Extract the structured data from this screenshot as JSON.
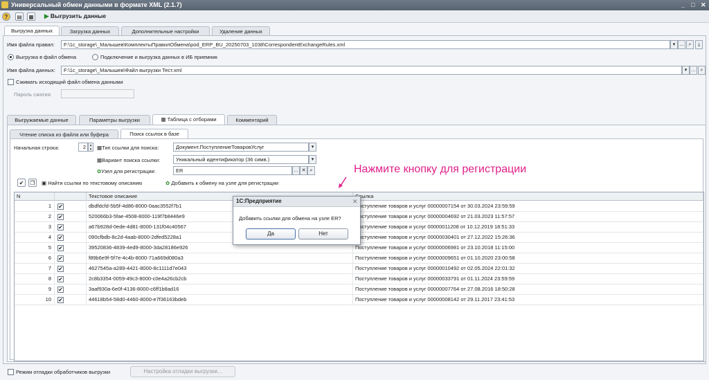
{
  "window": {
    "title": "Универсальный обмен данными в формате XML (2.1.7)"
  },
  "toolbar": {
    "export_label": "Выгрузить данные"
  },
  "main_tabs": [
    "Выгрузка данных",
    "Загрузка данных",
    "Дополнительные настройки",
    "Удаление данных"
  ],
  "rules": {
    "label": "Имя файла правил:",
    "value": "F:\\1c_storage\\_Малышев\\КомплектыПравилОбмена\\pod_ERP_BU_20250703_1038\\CorrespondentExchangeRules.xml"
  },
  "mode": {
    "option1": "Выгрузка в файл обмена",
    "option2": "Подключение и выгрузка данных в ИБ приемник"
  },
  "datafile": {
    "label": "Имя файла данных:",
    "value": "F:\\1c_storage\\_Малышев\\Файл выгрузки Тест.xml"
  },
  "compress": {
    "label": "Сжимать исходящий файл обмена данными",
    "password_label": "Пароль сжатия:"
  },
  "sub_tabs": [
    "Выгружаемые данные",
    "Параметры выгрузки",
    "Таблица с отборами",
    "Комментарий"
  ],
  "inner_tabs": [
    "Чтение списка из файла или буфера",
    "Поиск ссылок в базе"
  ],
  "search": {
    "start_row_label": "Начальная строка:",
    "start_row_value": "2",
    "ref_type_label": "Тип ссылки для поиска:",
    "ref_type_value": "Документ.ПоступлениеТоваровУслуг",
    "variant_label": "Вариант поиска ссылки:",
    "variant_value": "Уникальный идентификатор (36 симв.)",
    "node_label": "Узел для регистрации:",
    "node_value": "ER"
  },
  "actions": {
    "find_label": "Найти ссылки по текстовому описанию",
    "add_label": "Добавить к обмену на узле для регистрации"
  },
  "annotation": {
    "text": "Нажмите кнопку для регистрации",
    "color": "#e0208a"
  },
  "table": {
    "headers": {
      "n": "N",
      "text": "Текстовое описание",
      "ref": "Ссылка"
    },
    "rows": [
      {
        "n": "1",
        "text": "dbdfdcfd-5b5f-4d86-8000-0aac3552f7b1",
        "ref": "Поступление товаров и услуг 00000007154 от 30.03.2024 23:59:59"
      },
      {
        "n": "2",
        "text": "520066b3-5fae-4508-8000-119f7b8446e9",
        "ref": "Поступление товаров и услуг 00000004692 от 21.03.2023 11:57:57"
      },
      {
        "n": "3",
        "text": "a67b928d-0ede-4d81-8000-131f04c40567",
        "ref": "Поступление товаров и услуг 00000011208 от 10.12.2019 18:51:33"
      },
      {
        "n": "4",
        "text": "090cfbdb-8c2d-4aab-8000-2dfed5228a1",
        "ref": "Поступление товаров и услуг 00000030401 от 27.12.2022 15:26:36"
      },
      {
        "n": "5",
        "text": "39520836-4839-4ed9-8000-3da28186e926",
        "ref": "Поступление товаров и услуг 00000006981 от 23.10.2018 11:15:00"
      },
      {
        "n": "6",
        "text": "f89b6e9f-5f7e-4c4b-8000-71a669d080a3",
        "ref": "Поступление товаров и услуг 00000009651 от 01.10.2020 23:00:58"
      },
      {
        "n": "7",
        "text": "4627545a-a289-4421-8000-8c1111d7e043",
        "ref": "Поступление товаров и услуг 00000010492 от 02.05.2024 22:01:32"
      },
      {
        "n": "8",
        "text": "2c8b3354-0059-49c3-8000-c0e4a26cb2cb",
        "ref": "Поступление товаров и услуг 00000033791 от 01.11.2024 23:59:59"
      },
      {
        "n": "9",
        "text": "3aaf930a-6e0f-4136-8000-c6ff1b8ad16",
        "ref": "Поступление товаров и услуг 00000007764 от 27.08.2016 18:50:28"
      },
      {
        "n": "10",
        "text": "44618b54-58d0-4460-8000-e7f36163bdeb",
        "ref": "Поступление товаров и услуг 00000008142 от 29.11.2017 23:41:53"
      }
    ]
  },
  "dialog": {
    "title": "1С:Предприятие",
    "message": "Добавить ссылки для обмена на узле ER?",
    "yes": "Да",
    "no": "Нет"
  },
  "footer": {
    "debug_label": "Режим отладки обработчиков выгрузки",
    "debug_button": "Настройка отладки выгрузки..."
  }
}
